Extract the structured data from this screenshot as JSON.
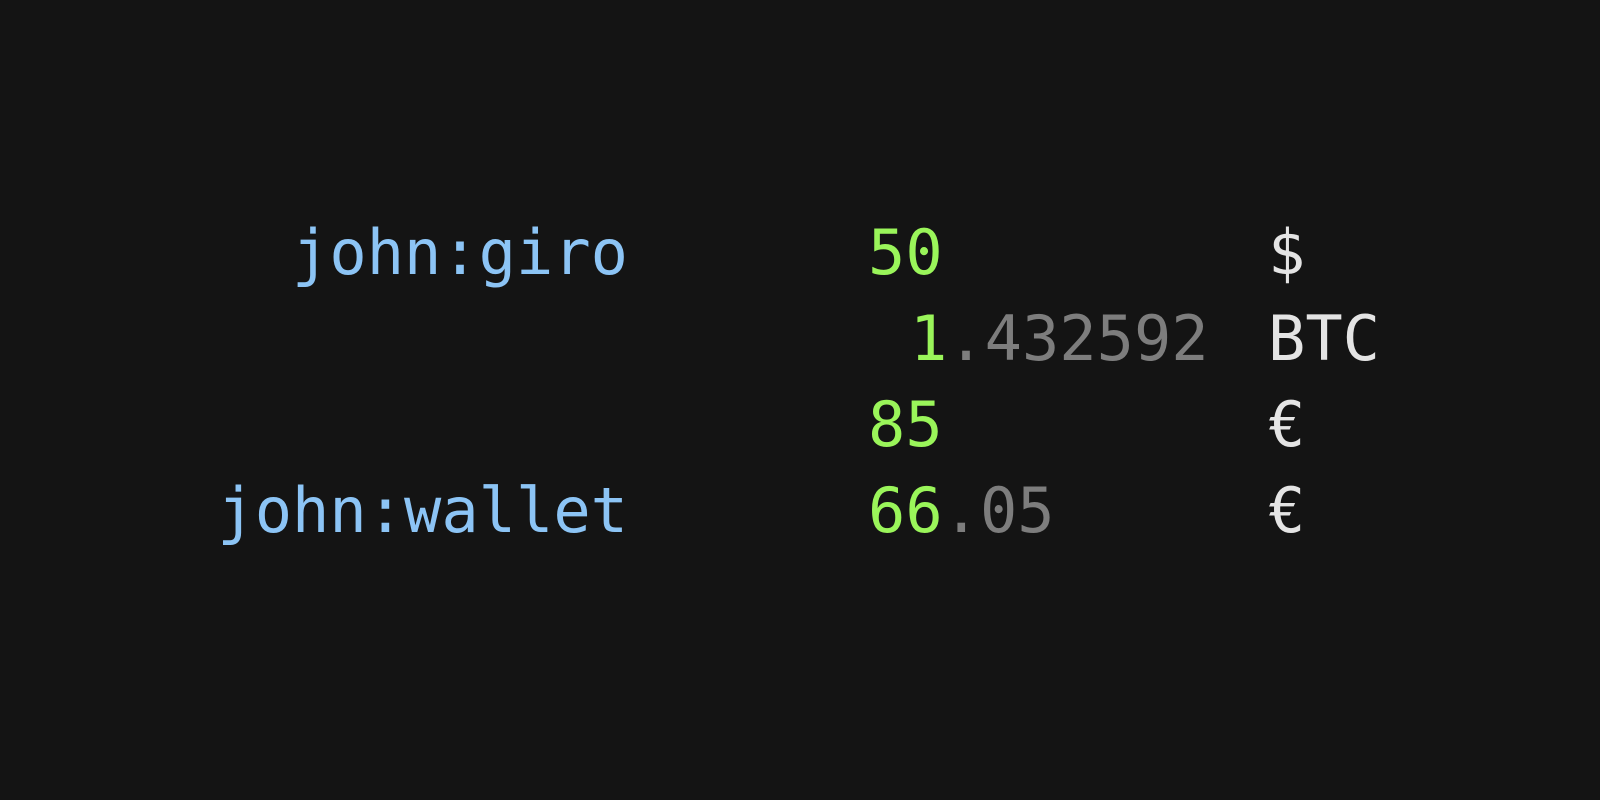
{
  "colors": {
    "background": "#141414",
    "account": "#8cc4f5",
    "amount_integer": "#9af55a",
    "amount_fraction": "#7d7d7d",
    "commodity": "#e4e4e4"
  },
  "balance_report": {
    "rows": [
      {
        "account": "john:giro",
        "amount_integer": "50",
        "amount_fraction": "",
        "commodity": "$"
      },
      {
        "account": "",
        "amount_integer": "1",
        "amount_fraction": ".432592",
        "commodity": "BTC"
      },
      {
        "account": "",
        "amount_integer": "85",
        "amount_fraction": "",
        "commodity": "€"
      },
      {
        "account": "john:wallet",
        "amount_integer": "66",
        "amount_fraction": ".05",
        "commodity": "€"
      }
    ]
  }
}
